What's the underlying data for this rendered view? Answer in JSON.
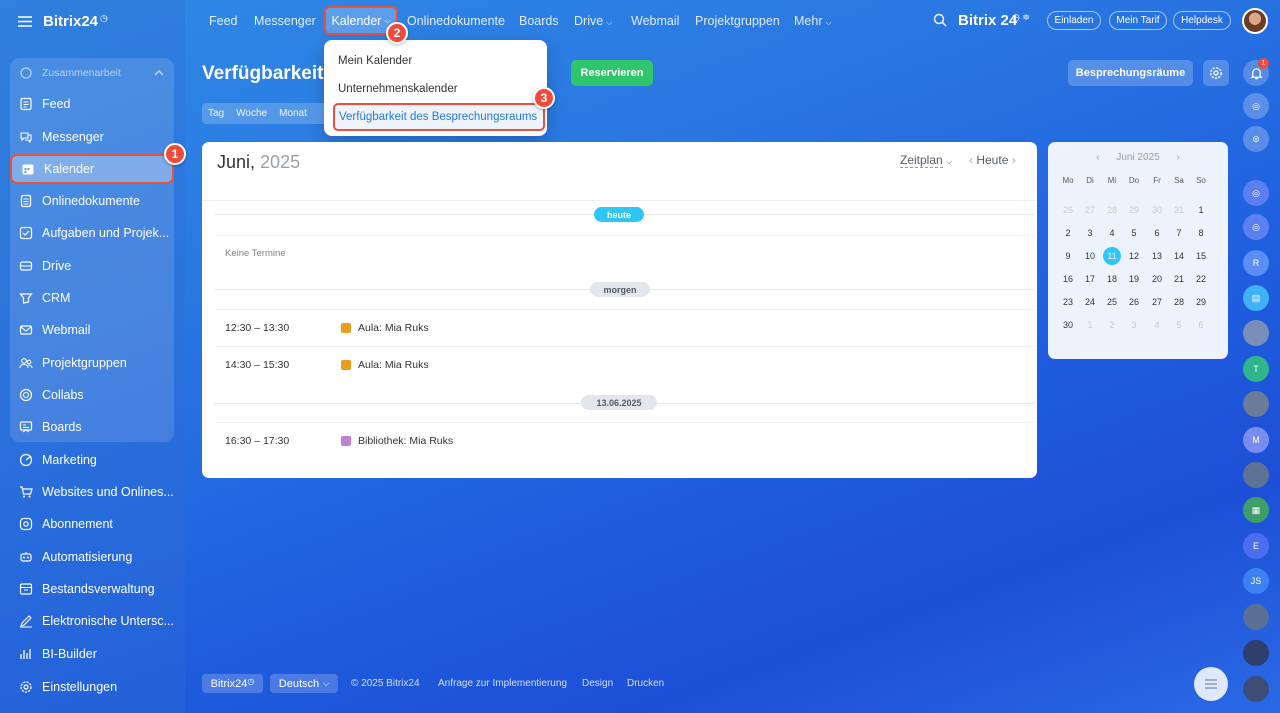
{
  "sidebar": {
    "logo": "Bitrix24",
    "group_label": "Zusammenarbeit",
    "items": [
      {
        "label": "Feed"
      },
      {
        "label": "Messenger"
      },
      {
        "label": "Kalender"
      },
      {
        "label": "Onlinedokumente"
      },
      {
        "label": "Aufgaben und Projek..."
      },
      {
        "label": "Drive"
      },
      {
        "label": "CRM"
      },
      {
        "label": "Webmail"
      },
      {
        "label": "Projektgruppen"
      },
      {
        "label": "Collabs"
      },
      {
        "label": "Boards"
      },
      {
        "label": "Marketing"
      },
      {
        "label": "Websites und Onlines..."
      },
      {
        "label": "Abonnement"
      },
      {
        "label": "Automatisierung"
      },
      {
        "label": "Bestandsverwaltung"
      },
      {
        "label": "Elektronische Untersc..."
      },
      {
        "label": "BI-Builder"
      },
      {
        "label": "Einstellungen"
      }
    ]
  },
  "topnav": {
    "items": [
      "Feed",
      "Messenger",
      "Kalender",
      "Onlinedokumente",
      "Boards",
      "Drive",
      "Webmail",
      "Projektgruppen",
      "Mehr"
    ],
    "logo": "Bitrix 24",
    "buttons": {
      "invite": "Einladen",
      "tariff": "Mein Tarif",
      "help": "Helpdesk"
    }
  },
  "dropdown": {
    "items": [
      "Mein Kalender",
      "Unternehmenskalender",
      "Verfügbarkeit des Besprechungsraums"
    ]
  },
  "badges": [
    "1",
    "2",
    "3"
  ],
  "header": {
    "title": "Verfügbarkeit d",
    "reserve_button": "Reservieren",
    "rooms_button": "Besprechungsräume",
    "view_tabs": [
      "Tag",
      "Woche",
      "Monat"
    ]
  },
  "panel": {
    "month": "Juni,",
    "year": "2025",
    "mode": "Zeitplan",
    "today_button": "Heute",
    "sections": {
      "today": "heute",
      "no_events": "Keine Termine",
      "tomorrow": "morgen",
      "date": "13.06.2025"
    },
    "events": [
      {
        "time": "12:30 – 13:30",
        "name": "Aula: Mia Ruks",
        "color": "#e89e1a"
      },
      {
        "time": "14:30 – 15:30",
        "name": "Aula: Mia Ruks",
        "color": "#e89e1a"
      },
      {
        "time": "16:30 – 17:30",
        "name": "Bibliothek: Mia Ruks",
        "color": "#c37fd3"
      }
    ]
  },
  "minical": {
    "title": "Juni 2025",
    "weekdays": [
      "Mo",
      "Di",
      "Mi",
      "Do",
      "Fr",
      "Sa",
      "So"
    ],
    "weeks": [
      [
        "26",
        "27",
        "28",
        "29",
        "30",
        "31",
        "1"
      ],
      [
        "2",
        "3",
        "4",
        "5",
        "6",
        "7",
        "8"
      ],
      [
        "9",
        "10",
        "11",
        "12",
        "13",
        "14",
        "15"
      ],
      [
        "16",
        "17",
        "18",
        "19",
        "20",
        "21",
        "22"
      ],
      [
        "23",
        "24",
        "25",
        "26",
        "27",
        "28",
        "29"
      ],
      [
        "30",
        "1",
        "2",
        "3",
        "4",
        "5",
        "6"
      ]
    ],
    "selected": "11"
  },
  "rail": {
    "notification_count": "1",
    "avatars": [
      "R",
      "T",
      "M",
      "E",
      "JS"
    ]
  },
  "footer": {
    "brand": "Bitrix24",
    "language": "Deutsch",
    "copyright": "© 2025 Bitrix24",
    "links": [
      "Anfrage zur Implementierung",
      "Design",
      "Drucken"
    ]
  },
  "colors": {
    "accent_red": "#e8513d",
    "green": "#2fc66b",
    "today_tag": "#2fc6f6",
    "selected_day": "#2fc6f6"
  }
}
